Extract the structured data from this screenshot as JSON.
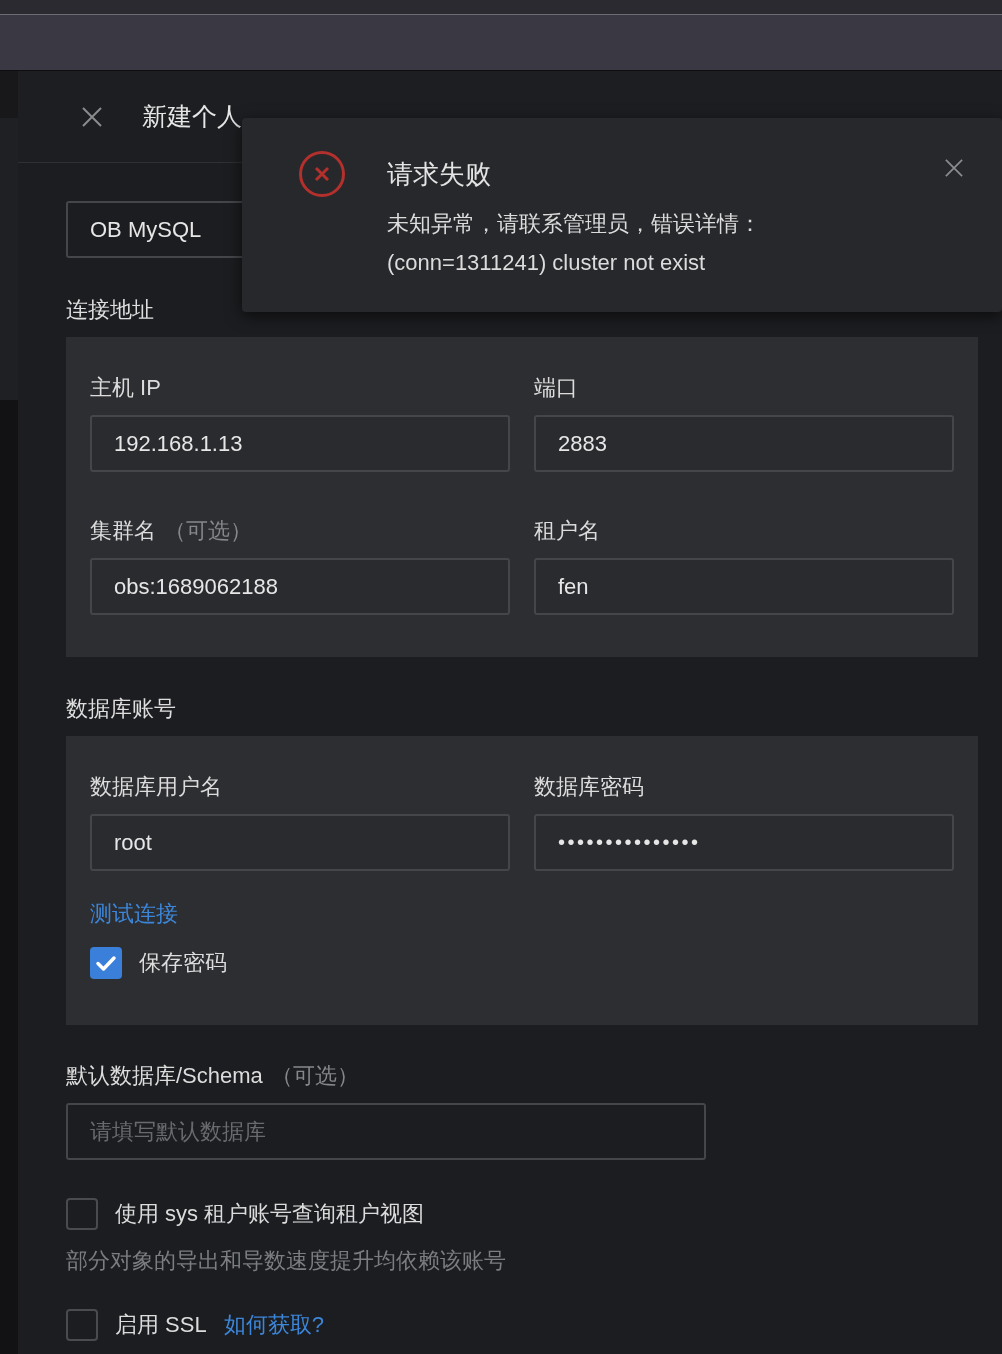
{
  "drawer": {
    "title": "新建个人"
  },
  "connection_type_field": {
    "value": "OB MySQL"
  },
  "address": {
    "title": "连接地址",
    "fields": [
      {
        "label": "主机 IP",
        "value": "192.168.1.13"
      },
      {
        "label": "端口",
        "value": "2883"
      },
      {
        "label": "集群名",
        "optional": "（可选）",
        "value": "obs:1689062188"
      },
      {
        "label": "租户名",
        "value": "fen"
      }
    ]
  },
  "account": {
    "title": "数据库账号",
    "fields": [
      {
        "label": "数据库用户名",
        "value": "root",
        "kind": "text"
      },
      {
        "label": "数据库密码",
        "value": "•••••••••••••••",
        "kind": "password"
      }
    ],
    "test_link": "测试连接",
    "save_password": {
      "label": "保存密码",
      "checked": true
    }
  },
  "default_schema": {
    "label": "默认数据库/Schema",
    "optional": "（可选）",
    "placeholder": "请填写默认数据库"
  },
  "options": [
    {
      "label": "使用 sys 租户账号查询租户视图",
      "checked": false,
      "help": "部分对象的导出和导数速度提升均依赖该账号"
    },
    {
      "label": "启用 SSL",
      "checked": false,
      "link": "如何获取?"
    }
  ],
  "notification": {
    "title": "请求失败",
    "message_lines": [
      "未知异常，请联系管理员，错误详情：",
      "(conn=1311241) cluster not exist"
    ]
  }
}
